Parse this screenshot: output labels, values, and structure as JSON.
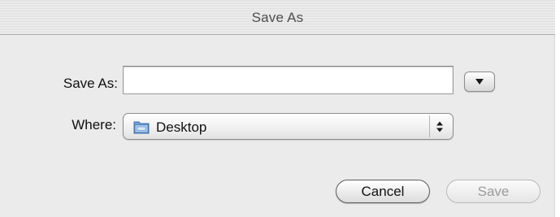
{
  "window": {
    "title": "Save As"
  },
  "form": {
    "save_as_label": "Save As:",
    "save_as_value": "",
    "where_label": "Where:",
    "where_value": "Desktop"
  },
  "buttons": {
    "cancel": "Cancel",
    "save": "Save",
    "save_enabled": false
  },
  "icons": {
    "expand": "disclosure-triangle-down",
    "location": "folder",
    "popup": "up-down-arrows"
  }
}
